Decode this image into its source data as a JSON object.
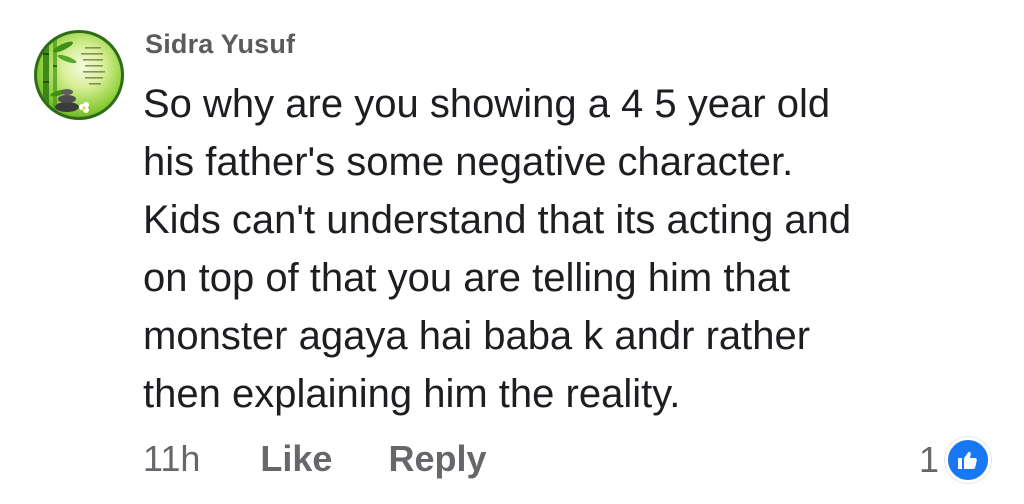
{
  "comment": {
    "author": "Sidra Yusuf",
    "avatar_icon": "profile-picture-bamboo-zen-stones",
    "body_lines": [
      "So why are you showing a 4 5 year old",
      "his father's some negative character.",
      "Kids can't understand that its acting and",
      "on top of that you are telling him that",
      "monster agaya hai baba k andr rather",
      "then explaining him the reality."
    ],
    "timestamp": "11h",
    "like_label": "Like",
    "reply_label": "Reply",
    "reaction_count": "1",
    "reaction_icon": "thumbs-up-icon",
    "colors": {
      "author": "#5a5b5d",
      "body_text": "#1c1e21",
      "secondary_text": "#65676b",
      "like_blue": "#1877f2"
    }
  }
}
